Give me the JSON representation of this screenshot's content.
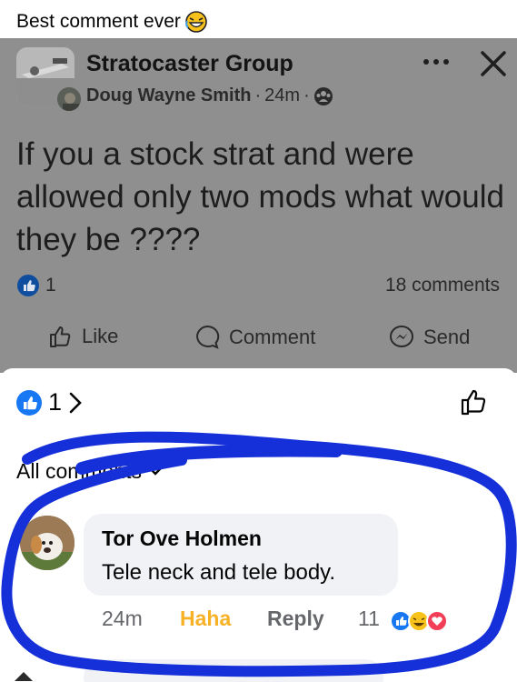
{
  "caption": {
    "text": "Best comment ever",
    "emoji": "rofl-emoji-icon"
  },
  "post": {
    "group_name": "Stratocaster Group",
    "author": "Doug Wayne Smith",
    "time": "24m",
    "text": "If you a stock strat and were allowed only two mods what would they be ????",
    "reaction_count": "1",
    "comment_count": "18 comments",
    "actions": {
      "like": "Like",
      "comment": "Comment",
      "send": "Send"
    }
  },
  "sheet": {
    "reaction_count": "1",
    "chevron": "›",
    "filter_label": "All comments",
    "comment": {
      "author": "Tor Ove Holmen",
      "text": "Tele neck and tele body.",
      "time": "24m",
      "haha_label": "Haha",
      "reply_label": "Reply",
      "reaction_count": "11"
    }
  },
  "colors": {
    "facebook_blue": "#1877f2",
    "haha_yellow": "#f7b125",
    "overlay_gray": "#8f8f8f",
    "scribble_blue": "#1530d8"
  }
}
